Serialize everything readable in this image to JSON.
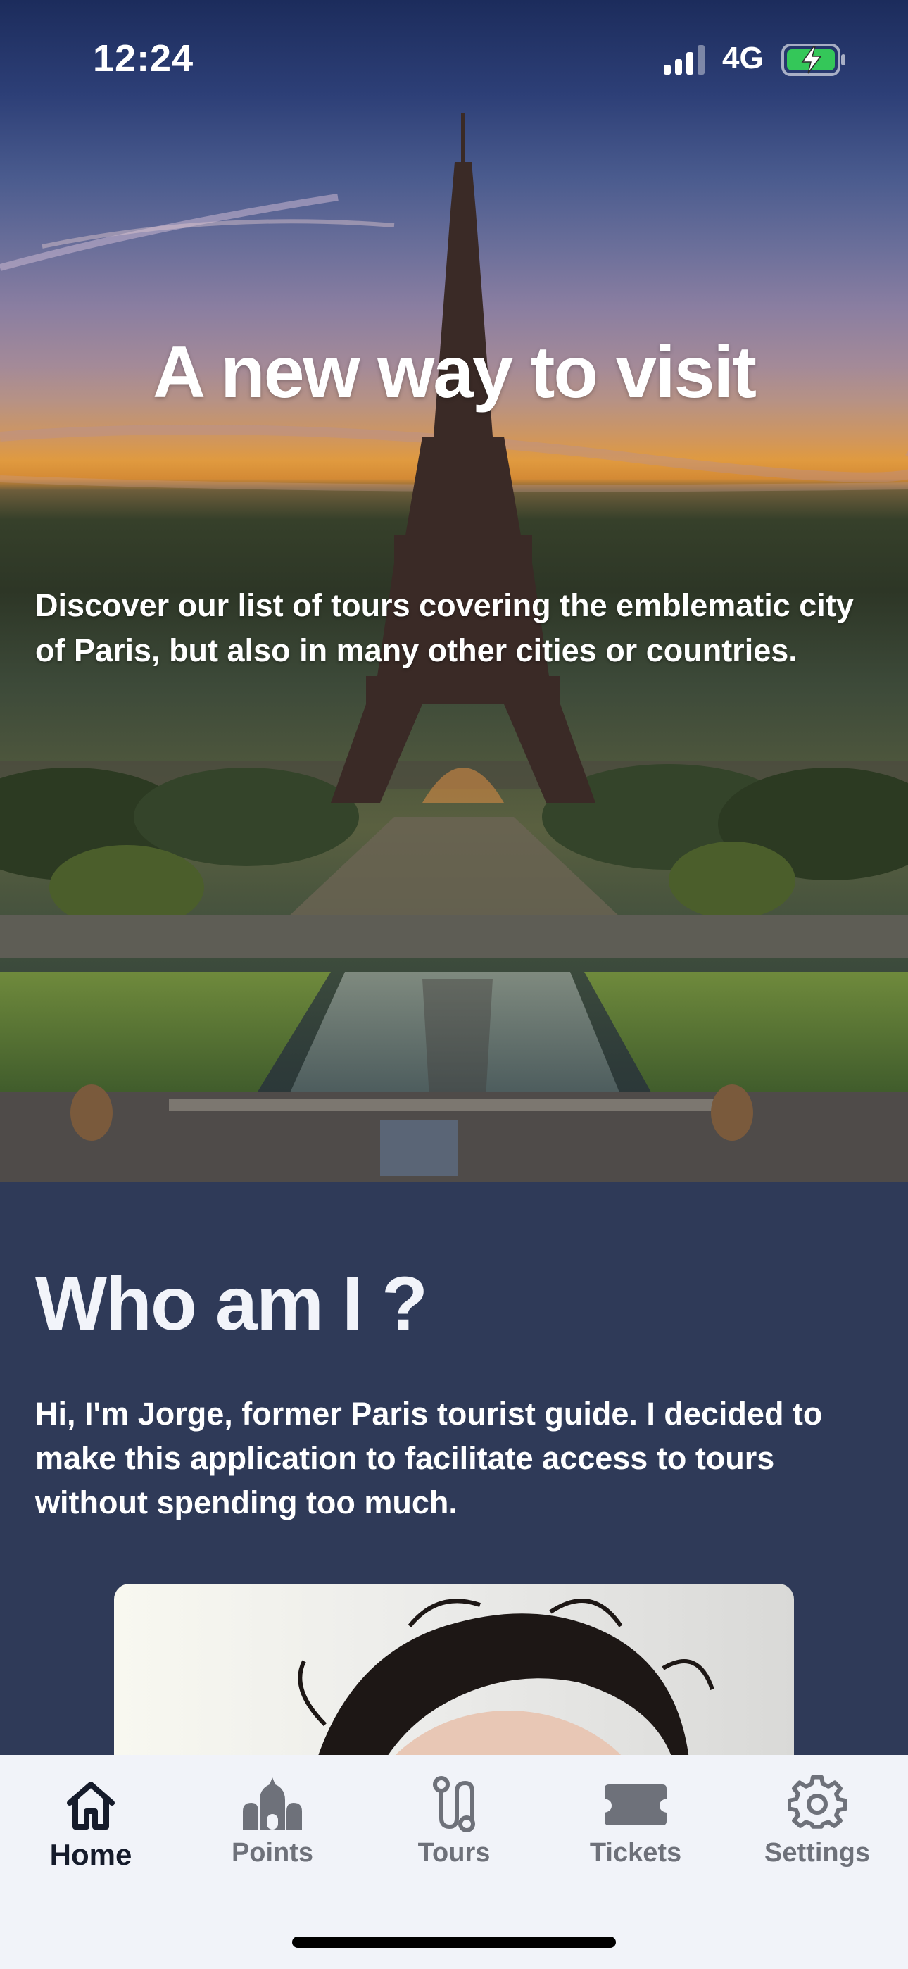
{
  "status_bar": {
    "time": "12:24",
    "network": "4G",
    "signal_icon": "cellular-signal-icon",
    "battery_icon": "battery-charging-icon",
    "battery_color": "#34c759"
  },
  "hero": {
    "title": "A new way to visit",
    "subtitle": "Discover our list of tours covering the emblematic city of Paris, but also in many other cities or countries.",
    "image": "eiffel-tower-sunset-photo"
  },
  "about": {
    "title": "Who am I ?",
    "text": "Hi, I'm Jorge, former Paris tourist guide. I decided to make this application to facilitate access to tours without spending too much.",
    "image": "profile-photo"
  },
  "tab_bar": {
    "active": "Home",
    "tabs": [
      {
        "label": "Home",
        "icon": "home-icon"
      },
      {
        "label": "Points",
        "icon": "landmark-icon"
      },
      {
        "label": "Tours",
        "icon": "route-icon"
      },
      {
        "label": "Tickets",
        "icon": "ticket-icon"
      },
      {
        "label": "Settings",
        "icon": "gear-icon"
      }
    ]
  },
  "colors": {
    "section_background": "#2f3a58",
    "tab_bar_background": "#f1f3f9",
    "tab_active": "#151b2b",
    "tab_inactive": "#6e717a"
  }
}
